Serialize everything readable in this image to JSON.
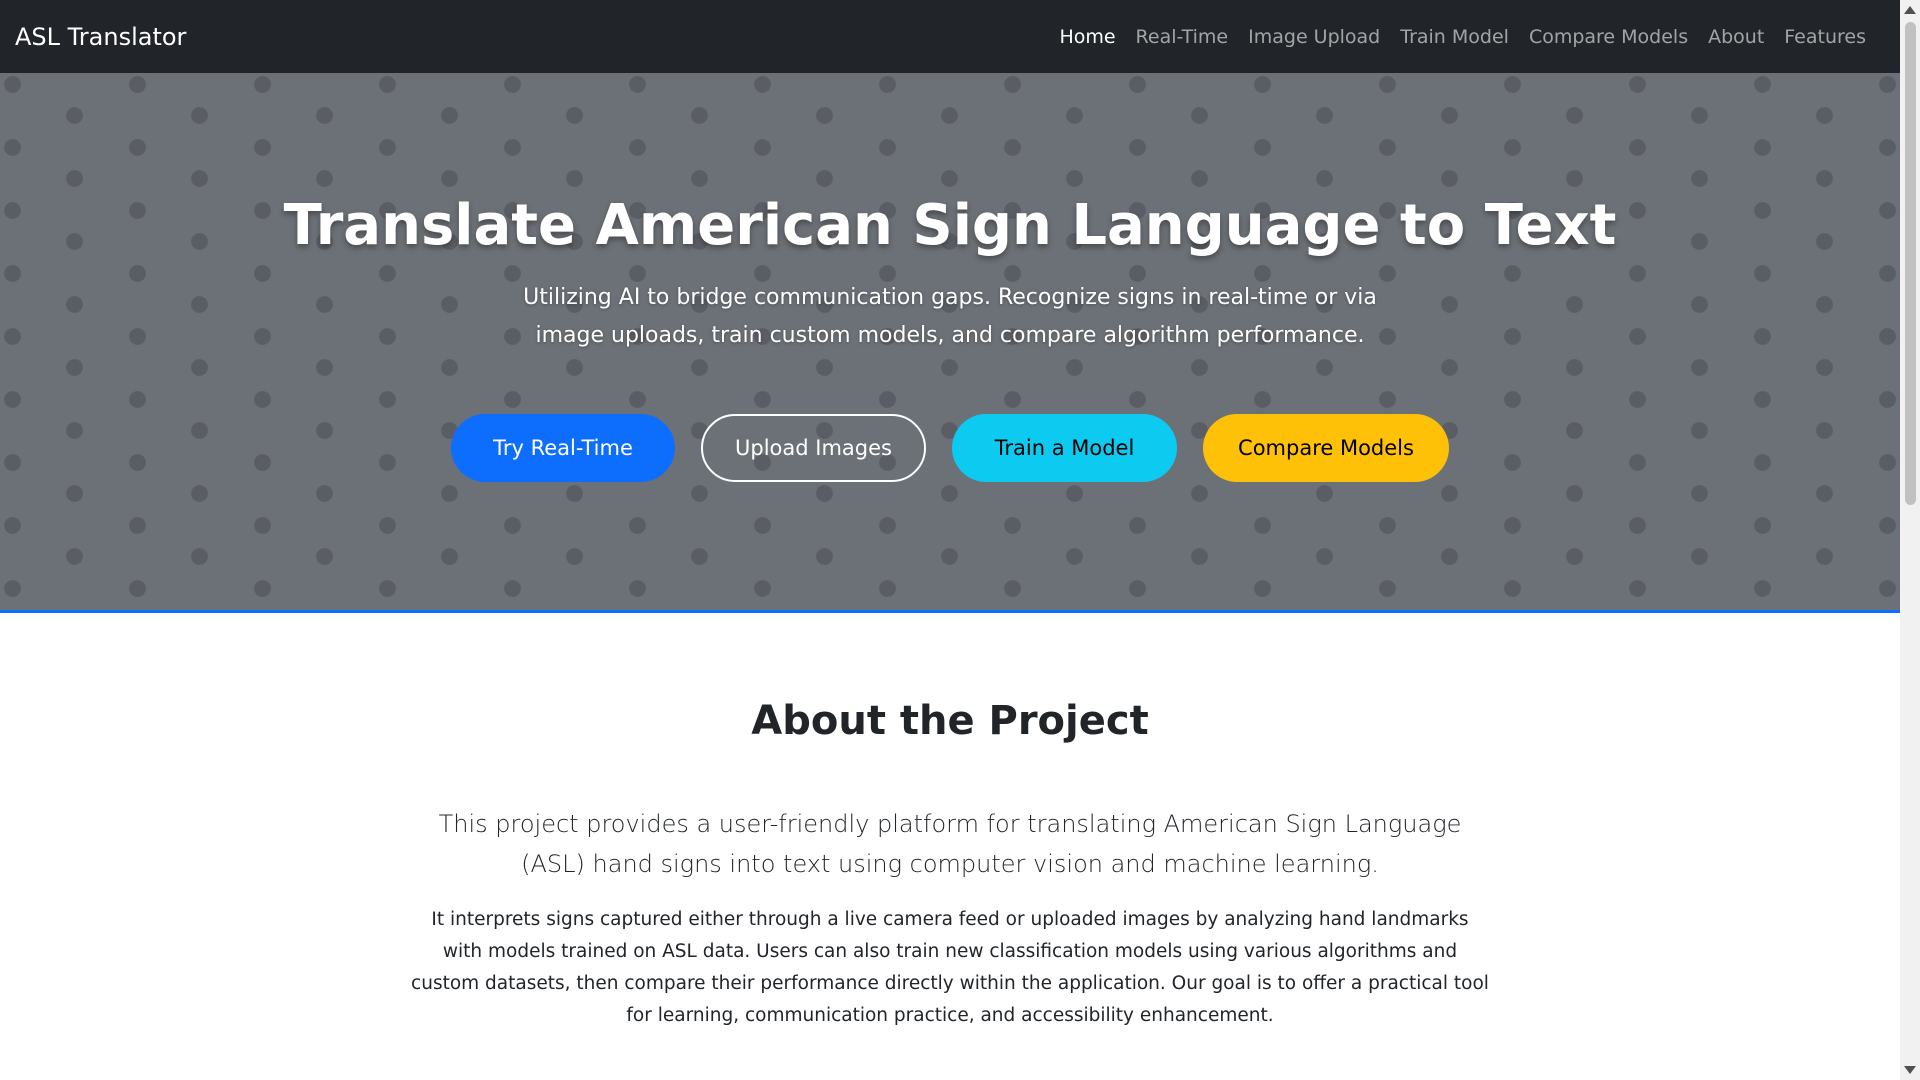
{
  "navbar": {
    "brand": "ASL Translator",
    "links": [
      {
        "label": "Home",
        "active": true
      },
      {
        "label": "Real-Time",
        "active": false
      },
      {
        "label": "Image Upload",
        "active": false
      },
      {
        "label": "Train Model",
        "active": false
      },
      {
        "label": "Compare Models",
        "active": false
      },
      {
        "label": "About",
        "active": false
      },
      {
        "label": "Features",
        "active": false
      }
    ]
  },
  "hero": {
    "title": "Translate American Sign Language to Text",
    "subtitle": "Utilizing AI to bridge communication gaps. Recognize signs in real-time or via image uploads, train custom models, and compare algorithm performance.",
    "buttons": {
      "realtime": "Try Real-Time",
      "upload": "Upload Images",
      "train": "Train a Model",
      "compare": "Compare Models"
    }
  },
  "about": {
    "title": "About the Project",
    "lead": "This project provides a user-friendly platform for translating American Sign Language (ASL) hand signs into text using computer vision and machine learning.",
    "body": "It interprets signs captured either through a live camera feed or uploaded images by analyzing hand landmarks with models trained on ASL data. Users can also train new classification models using various algorithms and custom datasets, then compare their performance directly within the application. Our goal is to offer a practical tool for learning, communication practice, and accessibility enhancement."
  },
  "colors": {
    "navbar_bg": "#212529",
    "hero_bg": "#6c7177",
    "hero_border": "#0d6efd",
    "btn_primary": "#0d6efd",
    "btn_info": "#0dcaf0",
    "btn_warning": "#ffc107"
  },
  "icons": {
    "scroll_up": "triangle-up-icon",
    "scroll_down": "triangle-down-icon"
  }
}
